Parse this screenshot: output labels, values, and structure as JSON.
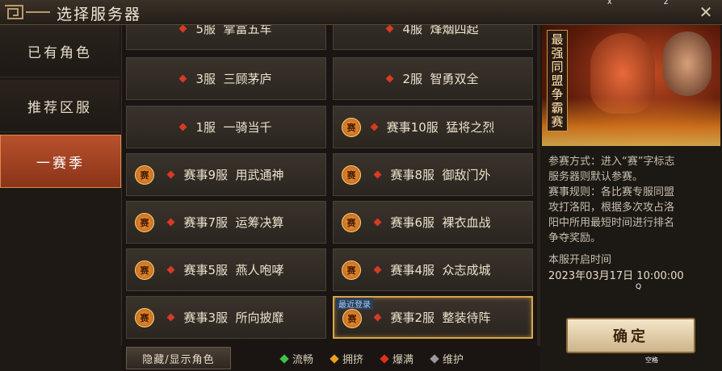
{
  "window": {
    "title": "选择服务器",
    "close_glyph": "✕",
    "hotkey_x": "X",
    "hotkey_z": "Z"
  },
  "sidebar": {
    "items": [
      {
        "label": "已有角色"
      },
      {
        "label": "推荐区服"
      },
      {
        "label": "一赛季",
        "active": true
      }
    ]
  },
  "servers": {
    "recent_tag": "最近登录",
    "rows": [
      {
        "left": {
          "num": "5服",
          "name": "掌富五车",
          "badge": false
        },
        "right": {
          "num": "4服",
          "name": "烽烟四起",
          "badge": false
        }
      },
      {
        "left": {
          "num": "3服",
          "name": "三顾茅庐",
          "badge": false
        },
        "right": {
          "num": "2服",
          "name": "智勇双全",
          "badge": false
        }
      },
      {
        "left": {
          "num": "1服",
          "name": "一骑当千",
          "badge": false
        },
        "right": {
          "num": "赛事10服",
          "name": "猛将之烈",
          "badge": true
        }
      },
      {
        "left": {
          "num": "赛事9服",
          "name": "用武通神",
          "badge": true
        },
        "right": {
          "num": "赛事8服",
          "name": "御敌门外",
          "badge": true
        }
      },
      {
        "left": {
          "num": "赛事7服",
          "name": "运筹决算",
          "badge": true
        },
        "right": {
          "num": "赛事6服",
          "name": "裸衣血战",
          "badge": true
        }
      },
      {
        "left": {
          "num": "赛事5服",
          "name": "燕人咆哮",
          "badge": true
        },
        "right": {
          "num": "赛事4服",
          "name": "众志成城",
          "badge": true
        }
      },
      {
        "left": {
          "num": "赛事3服",
          "name": "所向披靡",
          "badge": true
        },
        "right": {
          "num": "赛事2服",
          "name": "整装待阵",
          "badge": true,
          "selected": true
        }
      }
    ],
    "badge_glyph": "赛"
  },
  "panel": {
    "banner_title": "最强同盟争霸赛",
    "desc_lines": [
      "参赛方式：进入“赛”字标志",
      "服务器则默认参赛。",
      "赛事规则：各比赛专服同盟",
      "攻打洛阳，根据多次攻占洛",
      "阳中所用最短时间进行排名",
      "争夺奖励。"
    ],
    "open_label": "本服开启时间",
    "open_time": "2023年03月17日   10:00:00",
    "q_hint": "Q",
    "confirm_label": "确定",
    "space_hint": "空格"
  },
  "bottom": {
    "toggle_label": "隐藏/显示角色",
    "legend": [
      {
        "label": "流畅",
        "color": "#3cc44a"
      },
      {
        "label": "拥挤",
        "color": "#e8a020"
      },
      {
        "label": "爆满",
        "color": "#e03020"
      },
      {
        "label": "维护",
        "color": "#9a9a9a"
      }
    ]
  }
}
